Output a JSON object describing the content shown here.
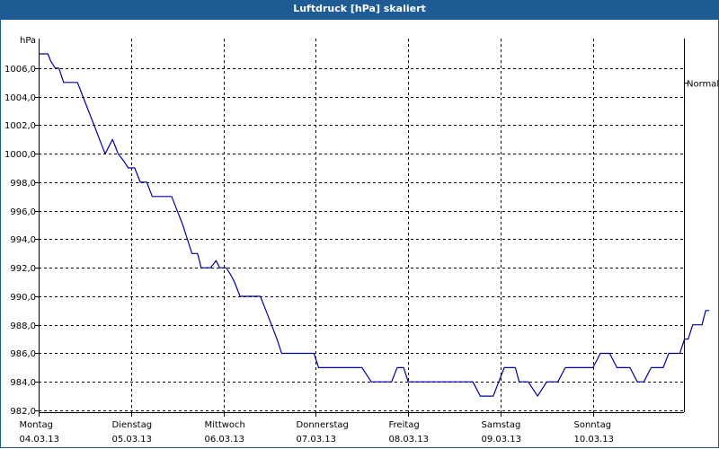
{
  "window": {
    "title": "Luftdruck [hPa] skaliert"
  },
  "chart_data": {
    "type": "line",
    "ylabel": "hPa",
    "ylim": [
      982.0,
      1007.0
    ],
    "yticks": [
      "982,0",
      "984,0",
      "986,0",
      "988,0",
      "990,0",
      "992,0",
      "994,0",
      "996,0",
      "998,0",
      "1000,0",
      "1002,0",
      "1004,0",
      "1006,0"
    ],
    "reference_label": "Normal",
    "reference_value": 1005.0,
    "xlim": [
      0,
      7
    ],
    "days": [
      {
        "weekday": "Montag",
        "date": "04.03.13"
      },
      {
        "weekday": "Dienstag",
        "date": "05.03.13"
      },
      {
        "weekday": "Mittwoch",
        "date": "06.03.13"
      },
      {
        "weekday": "Donnerstag",
        "date": "07.03.13"
      },
      {
        "weekday": "Freitag",
        "date": "08.03.13"
      },
      {
        "weekday": "Samstag",
        "date": "09.03.13"
      },
      {
        "weekday": "Sonntag",
        "date": "10.03.13"
      }
    ],
    "grid": true,
    "series": [
      {
        "color": "#0000a0",
        "points": [
          [
            0.0,
            1007
          ],
          [
            0.1,
            1007
          ],
          [
            0.13,
            1006.5
          ],
          [
            0.18,
            1006
          ],
          [
            0.22,
            1006
          ],
          [
            0.27,
            1005
          ],
          [
            0.37,
            1005
          ],
          [
            0.42,
            1005
          ],
          [
            0.48,
            1004
          ],
          [
            0.54,
            1003
          ],
          [
            0.6,
            1002
          ],
          [
            0.66,
            1001
          ],
          [
            0.72,
            1000
          ],
          [
            0.8,
            1001
          ],
          [
            0.86,
            1000
          ],
          [
            0.92,
            999.5
          ],
          [
            0.97,
            999
          ],
          [
            1.04,
            999
          ],
          [
            1.1,
            998
          ],
          [
            1.17,
            998
          ],
          [
            1.23,
            997
          ],
          [
            1.44,
            997
          ],
          [
            1.5,
            996
          ],
          [
            1.56,
            995
          ],
          [
            1.61,
            994
          ],
          [
            1.66,
            993
          ],
          [
            1.72,
            993
          ],
          [
            1.76,
            992
          ],
          [
            1.86,
            992
          ],
          [
            1.92,
            992.5
          ],
          [
            1.96,
            992
          ],
          [
            2.03,
            992
          ],
          [
            2.08,
            991.5
          ],
          [
            2.12,
            991
          ],
          [
            2.18,
            990
          ],
          [
            2.4,
            990
          ],
          [
            2.46,
            989
          ],
          [
            2.52,
            988
          ],
          [
            2.58,
            987
          ],
          [
            2.63,
            986
          ],
          [
            2.98,
            986
          ],
          [
            3.03,
            985
          ],
          [
            3.5,
            985
          ],
          [
            3.6,
            984
          ],
          [
            3.82,
            984
          ],
          [
            3.88,
            985
          ],
          [
            3.95,
            985
          ],
          [
            4.0,
            984
          ],
          [
            4.7,
            984
          ],
          [
            4.78,
            983
          ],
          [
            4.92,
            983
          ],
          [
            4.98,
            984
          ],
          [
            5.04,
            985
          ],
          [
            5.16,
            985
          ],
          [
            5.2,
            984
          ],
          [
            5.3,
            984
          ],
          [
            5.4,
            983
          ],
          [
            5.5,
            984
          ],
          [
            5.62,
            984
          ],
          [
            5.7,
            985
          ],
          [
            6.0,
            985
          ],
          [
            6.08,
            986
          ],
          [
            6.18,
            986
          ],
          [
            6.26,
            985
          ],
          [
            6.4,
            985
          ],
          [
            6.48,
            984
          ],
          [
            6.55,
            984
          ],
          [
            6.63,
            985
          ],
          [
            6.76,
            985
          ],
          [
            6.82,
            986
          ],
          [
            6.94,
            986
          ],
          [
            6.99,
            987
          ],
          [
            7.03,
            987
          ],
          [
            7.08,
            988
          ],
          [
            7.18,
            988
          ],
          [
            7.22,
            989
          ],
          [
            7.26,
            989
          ]
        ]
      }
    ]
  }
}
